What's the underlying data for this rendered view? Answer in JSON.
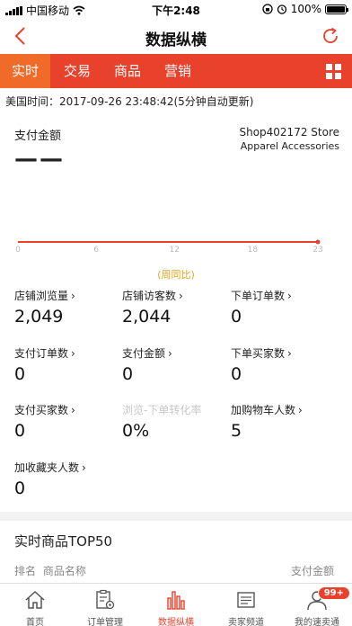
{
  "status_bar": {
    "carrier": "中国移动",
    "time": "下午2:48",
    "battery": "100%"
  },
  "nav": {
    "title": "数据纵横"
  },
  "tabs": [
    {
      "label": "实时",
      "active": true
    },
    {
      "label": "交易",
      "active": false
    },
    {
      "label": "商品",
      "active": false
    },
    {
      "label": "营销",
      "active": false
    }
  ],
  "updated_text": "美国时间：2017-09-26 23:48:42(5分钟自动更新)",
  "payment": {
    "label": "支付金额",
    "value": "——"
  },
  "shop": {
    "name": "Shop402172 Store",
    "category": "Apparel Accessories"
  },
  "chart_data": {
    "type": "line",
    "x": [
      0,
      6,
      12,
      18,
      23
    ],
    "tick_labels": [
      "0",
      "6",
      "12",
      "18",
      "23"
    ],
    "values": [
      0,
      0,
      0,
      0,
      0
    ],
    "xlim": [
      0,
      23
    ],
    "line_color": "#e8412c",
    "compare_label": "(周同比)"
  },
  "metrics": [
    {
      "label": "店铺浏览量",
      "value": "2,049",
      "enabled": true
    },
    {
      "label": "店铺访客数",
      "value": "2,044",
      "enabled": true
    },
    {
      "label": "下单订单数",
      "value": "0",
      "enabled": true
    },
    {
      "label": "支付订单数",
      "value": "0",
      "enabled": true
    },
    {
      "label": "支付金额",
      "value": "0",
      "enabled": true
    },
    {
      "label": "下单买家数",
      "value": "0",
      "enabled": true
    },
    {
      "label": "支付买家数",
      "value": "0",
      "enabled": true
    },
    {
      "label": "浏览-下单转化率",
      "value": "0%",
      "enabled": false
    },
    {
      "label": "加购物车人数",
      "value": "5",
      "enabled": true
    },
    {
      "label": "加收藏夹人数",
      "value": "0",
      "enabled": true
    }
  ],
  "top50": {
    "title": "实时商品TOP50",
    "col_rank": "排名",
    "col_name": "商品名称",
    "col_pay": "支付金额"
  },
  "bottom_tabs": [
    {
      "label": "首页",
      "icon": "home-icon",
      "active": false
    },
    {
      "label": "订单管理",
      "icon": "order-icon",
      "active": false
    },
    {
      "label": "数据纵横",
      "icon": "data-chart-icon",
      "active": true
    },
    {
      "label": "卖家频道",
      "icon": "seller-channel-icon",
      "active": false
    },
    {
      "label": "我的速卖通",
      "icon": "profile-icon",
      "active": false
    }
  ],
  "badge": "99+",
  "colors": {
    "brand_red": "#e8412c",
    "tab_active": "#f06a2a",
    "compare_text": "#e3a51c"
  }
}
